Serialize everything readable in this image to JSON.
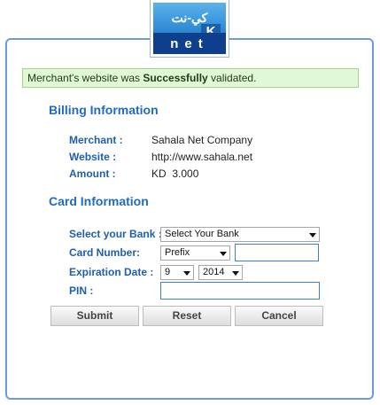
{
  "logo": {
    "arabic_text": "كي-نت",
    "letter": "K",
    "net_text": "net"
  },
  "message": {
    "prefix": "Merchant's website was ",
    "emphasis": "Successfully",
    "suffix": " validated."
  },
  "billing": {
    "title": "Billing Information",
    "merchant_label": "Merchant :",
    "merchant_value": "Sahala Net Company",
    "website_label": "Website :",
    "website_value": "http://www.sahala.net",
    "amount_label": "Amount :",
    "amount_value": "KD  3.000"
  },
  "card": {
    "title": "Card Information",
    "bank_label": "Select your Bank :",
    "bank_selected": "Select Your Bank",
    "card_number_label": "Card Number:",
    "prefix_selected": "Prefix",
    "expiration_label": "Expiration Date :",
    "month_selected": "9",
    "year_selected": "2014",
    "pin_label": "PIN :"
  },
  "buttons": {
    "submit": "Submit",
    "reset": "Reset",
    "cancel": "Cancel"
  }
}
